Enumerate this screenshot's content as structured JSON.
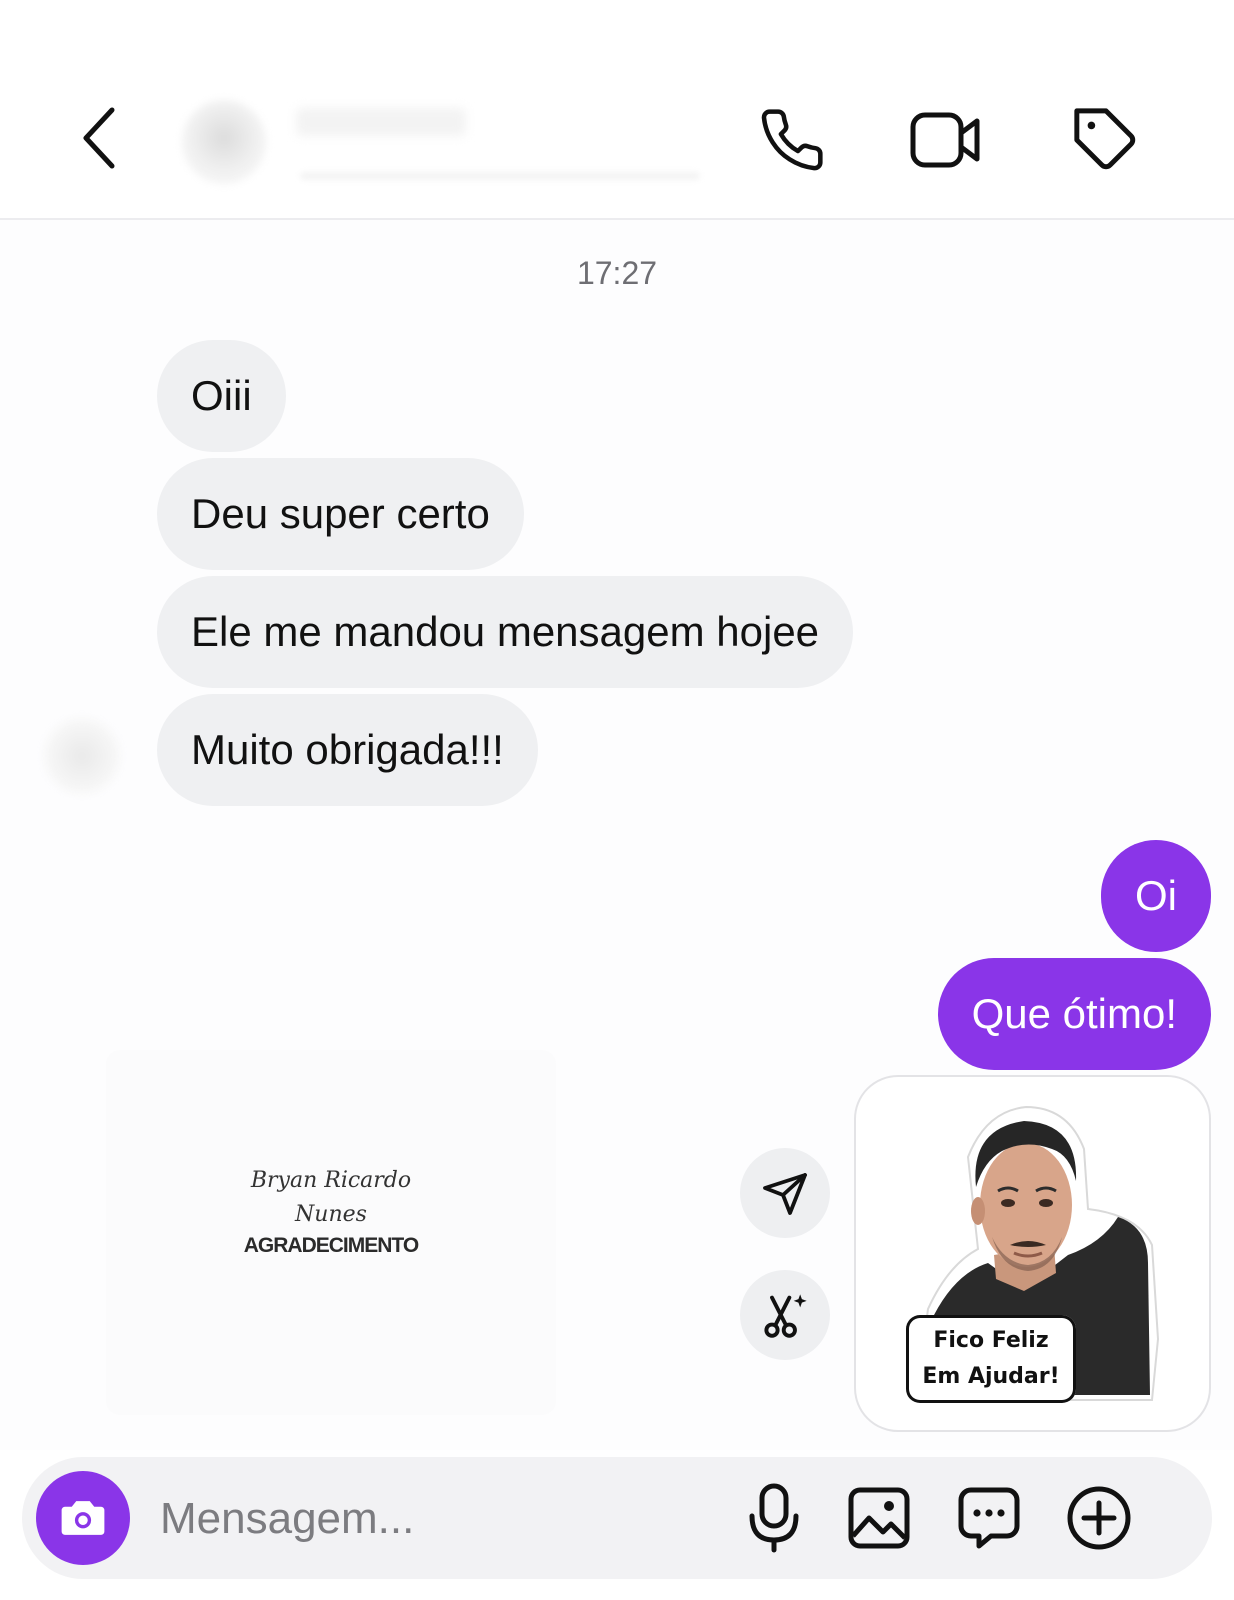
{
  "header": {
    "back_icon": "chevron-left-icon",
    "call_icon": "phone-icon",
    "video_icon": "video-camera-icon",
    "tag_icon": "tag-icon"
  },
  "conversation": {
    "timestamp": "17:27",
    "incoming": [
      {
        "text": "Oiii"
      },
      {
        "text": "Deu super certo"
      },
      {
        "text": "Ele me mandou mensagem hojee"
      },
      {
        "text": "Muito obrigada!!!"
      }
    ],
    "outgoing": [
      {
        "text": "Oi"
      },
      {
        "text": "Que ótimo!"
      }
    ],
    "shared_card": {
      "name_line1": "Bryan Ricardo",
      "name_line2": "Nunes",
      "title": "AGRADECIMENTO"
    },
    "sticker": {
      "caption_line1": "Fico Feliz",
      "caption_line2": "Em Ajudar!"
    },
    "actions": {
      "send_icon": "send-icon",
      "scissors_icon": "scissors-sparkle-icon"
    }
  },
  "composer": {
    "placeholder": "Mensagem...",
    "camera_icon": "camera-icon",
    "mic_icon": "microphone-icon",
    "gallery_icon": "image-icon",
    "chat_icon": "chat-bubble-icon",
    "plus_icon": "plus-circle-icon"
  },
  "colors": {
    "accent": "#8a35e8",
    "incoming_bubble": "#eff0f2",
    "timestamp": "#6e6e73"
  }
}
